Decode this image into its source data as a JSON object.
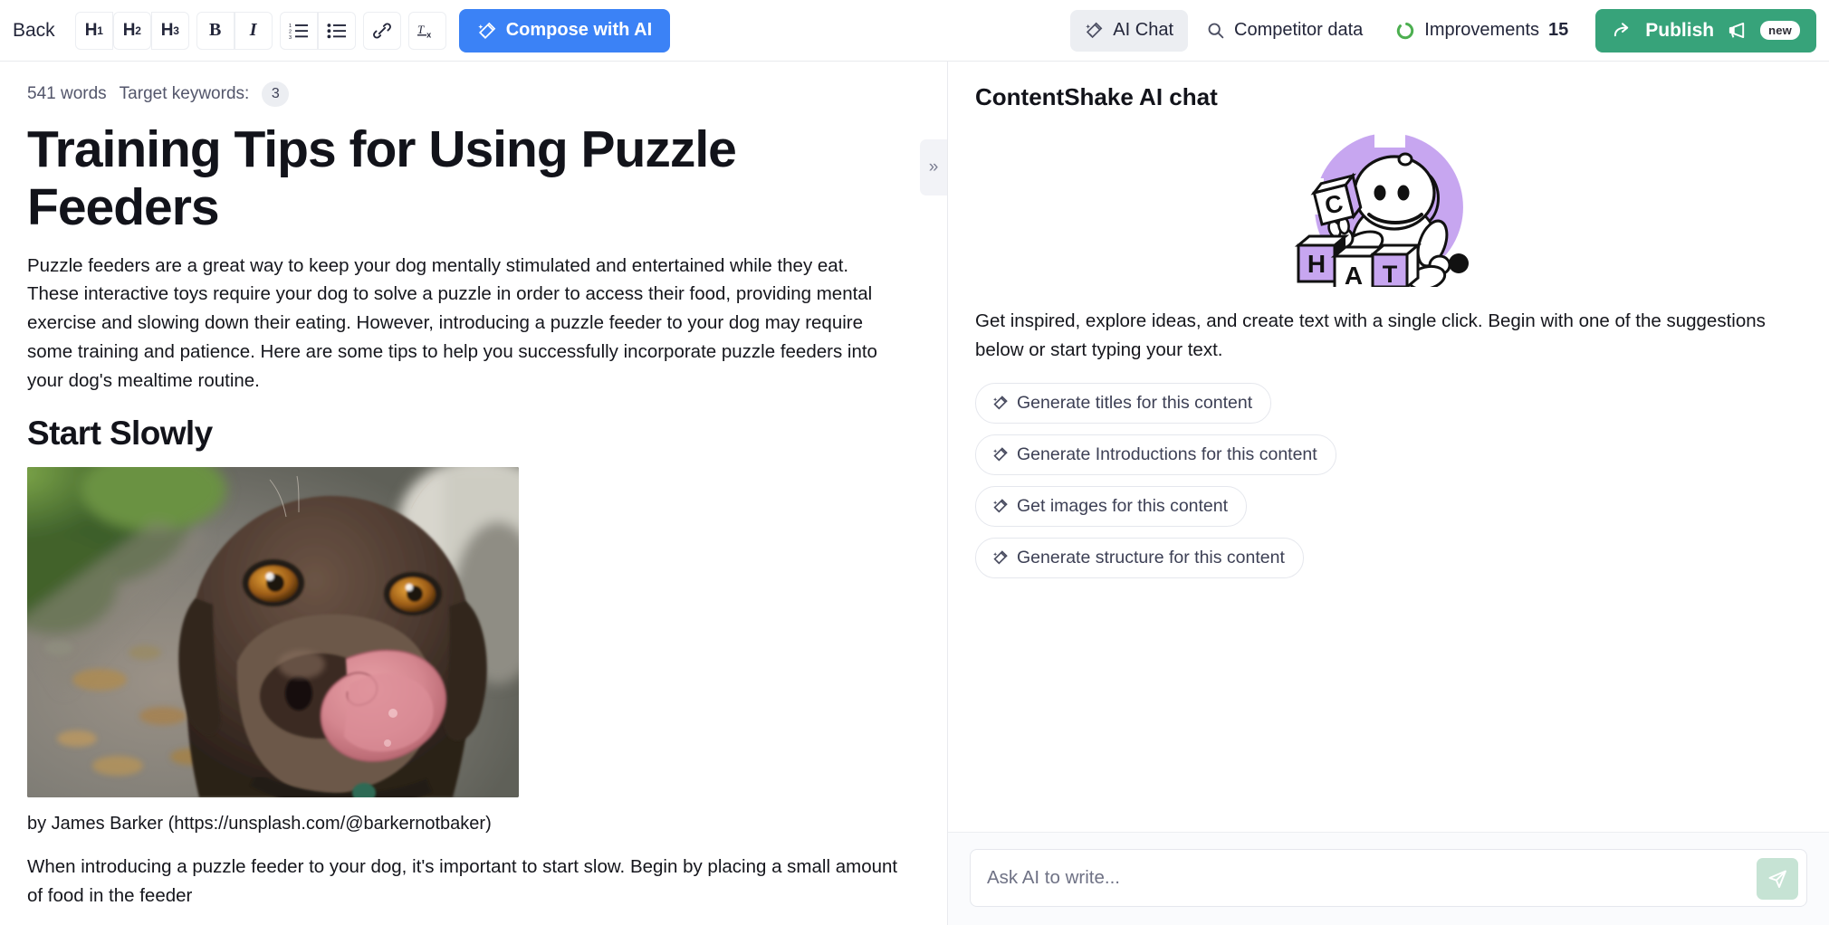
{
  "toolbar": {
    "back_label": "Back",
    "heading_buttons": [
      {
        "name": "h1-button",
        "label": "H",
        "sub": "1"
      },
      {
        "name": "h2-button",
        "label": "H",
        "sub": "2"
      },
      {
        "name": "h3-button",
        "label": "H",
        "sub": "3"
      }
    ],
    "bold_label": "B",
    "italic_label": "I",
    "ordered_list_icon": "ordered-list-icon",
    "bullet_list_icon": "bullet-list-icon",
    "link_icon": "link-icon",
    "clear_format_label": "Tx",
    "compose_label": "Compose with AI",
    "compose_color": "#3b82f6",
    "ai_chat_label": "AI Chat",
    "competitor_data_label": "Competitor data",
    "improvements_label": "Improvements",
    "improvements_count": "15",
    "improvements_ring_color": "#4caf50",
    "publish_label": "Publish",
    "publish_color": "#37a37a",
    "new_badge_label": "new"
  },
  "editor": {
    "word_count": "541 words",
    "target_keywords_label": "Target keywords:",
    "target_keywords_count": "3",
    "title": "Training Tips for Using Puzzle Feeders",
    "paragraph_1": "Puzzle feeders are a great way to keep your dog mentally stimulated and entertained while they eat. These interactive toys require your dog to solve a puzzle in order to access their food, providing mental exercise and slowing down their eating. However, introducing a puzzle feeder to your dog may require some training and patience. Here are some tips to help you successfully incorporate puzzle feeders into your dog's mealtime routine.",
    "heading_2": "Start Slowly",
    "image_alt": "dog-licking-nose-photo",
    "caption": "by James Barker (https://unsplash.com/@barkernotbaker)",
    "paragraph_2": "When introducing a puzzle feeder to your dog, it's important to start slow. Begin by placing a small amount of food in the feeder",
    "collapse_icon": "»"
  },
  "chat": {
    "title": "ContentShake AI chat",
    "illustration_name": "contentshake-robot-illustration",
    "illustration_accent": "#c7a6f0",
    "illustration_blocks": [
      "C",
      "H",
      "A",
      "T"
    ],
    "intro": "Get inspired, explore ideas, and create text with a single click. Begin with one of the suggestions below or start typing your text.",
    "suggestions": [
      {
        "label": "Generate titles for this content",
        "icon": "magic-wand-icon"
      },
      {
        "label": "Generate Introductions for this content",
        "icon": "magic-wand-icon"
      },
      {
        "label": "Get images for this content",
        "icon": "magic-wand-icon"
      },
      {
        "label": "Generate structure for this content",
        "icon": "magic-wand-icon"
      }
    ],
    "input_placeholder": "Ask AI to write...",
    "input_value": "",
    "send_icon": "send-icon",
    "send_button_color": "#c6e3d4"
  }
}
